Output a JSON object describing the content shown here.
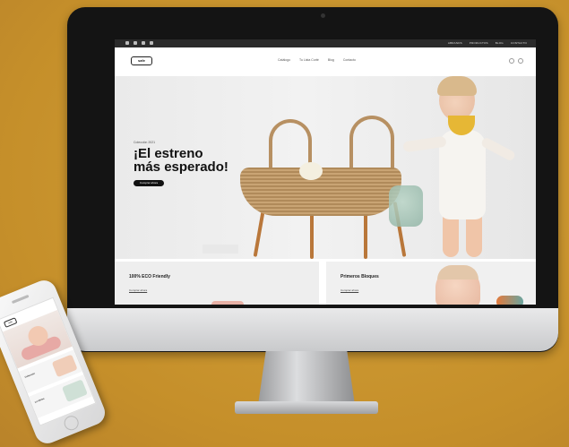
{
  "site": {
    "logo": "safe",
    "topbar_links": [
      "ABRANDS",
      "PRODUCTOS",
      "BLOG",
      "CONTACTO"
    ],
    "nav": [
      "Catálogo",
      "Tu Lista Corté",
      "Blog",
      "Contacto"
    ],
    "hero": {
      "tagline": "Colección 2021",
      "title": "¡El estreno más esperado!",
      "button": "Comprar ahora"
    },
    "tiles": [
      {
        "title": "100% ECO Friendly",
        "link": "Comprar ahora"
      },
      {
        "title": "Primeros Bloques",
        "link": "Comprar ahora"
      }
    ]
  },
  "phone": {
    "logo": "safe",
    "rows": [
      "Colección",
      "Lo último"
    ]
  },
  "colors": {
    "background": "#c9962f",
    "accent_yellow": "#e6b735",
    "wood": "#b9773a"
  }
}
